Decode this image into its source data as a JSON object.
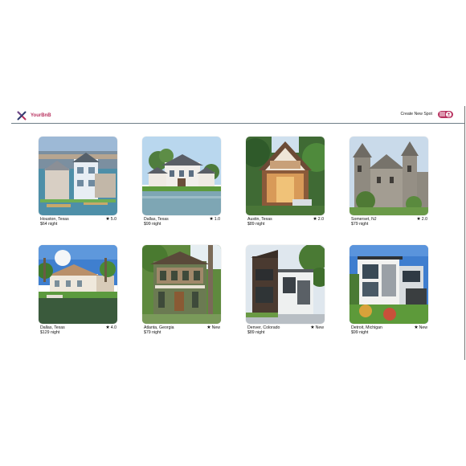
{
  "brand": {
    "name": "YourBnB",
    "color": "#b8315f"
  },
  "nav": {
    "create_label": "Create New Spot"
  },
  "spots": [
    {
      "location": "Houston, Texas",
      "price": "$64 night",
      "rating": "5.0"
    },
    {
      "location": "Dallas, Texas",
      "price": "$99 night",
      "rating": "1.0"
    },
    {
      "location": "Austin, Texas",
      "price": "$89 night",
      "rating": "2.0"
    },
    {
      "location": "Somerset, NJ",
      "price": "$79 night",
      "rating": "2.0"
    },
    {
      "location": "Dallas, Texas",
      "price": "$129 night",
      "rating": "4.0"
    },
    {
      "location": "Atlanta, Georgia",
      "price": "$79 night",
      "rating": "New"
    },
    {
      "location": "Denver, Colorado",
      "price": "$89 night",
      "rating": "New"
    },
    {
      "location": "Detroit, Michigan",
      "price": "$99 night",
      "rating": "New"
    }
  ],
  "icons": {
    "logo": "x-logo-icon",
    "star": "star-icon",
    "menu": "hamburger-icon",
    "user": "user-circle-icon"
  }
}
